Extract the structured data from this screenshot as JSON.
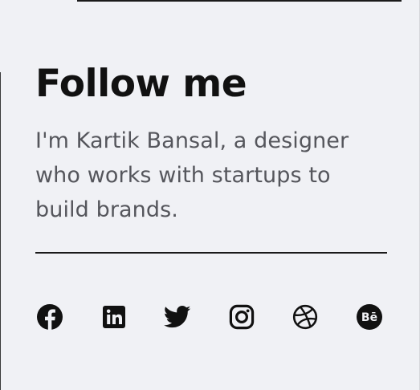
{
  "title": "Follow me",
  "bio": "I'm Kartik Bansal, a designer who works with startups to build brands.",
  "social": {
    "color": "#111111",
    "links": [
      {
        "name": "Facebook",
        "icon": "facebook-icon"
      },
      {
        "name": "LinkedIn",
        "icon": "linkedin-icon"
      },
      {
        "name": "Twitter",
        "icon": "twitter-icon"
      },
      {
        "name": "Instagram",
        "icon": "instagram-icon"
      },
      {
        "name": "Dribbble",
        "icon": "dribbble-icon"
      },
      {
        "name": "Behance",
        "icon": "behance-icon",
        "glyph": "Bē"
      }
    ]
  }
}
